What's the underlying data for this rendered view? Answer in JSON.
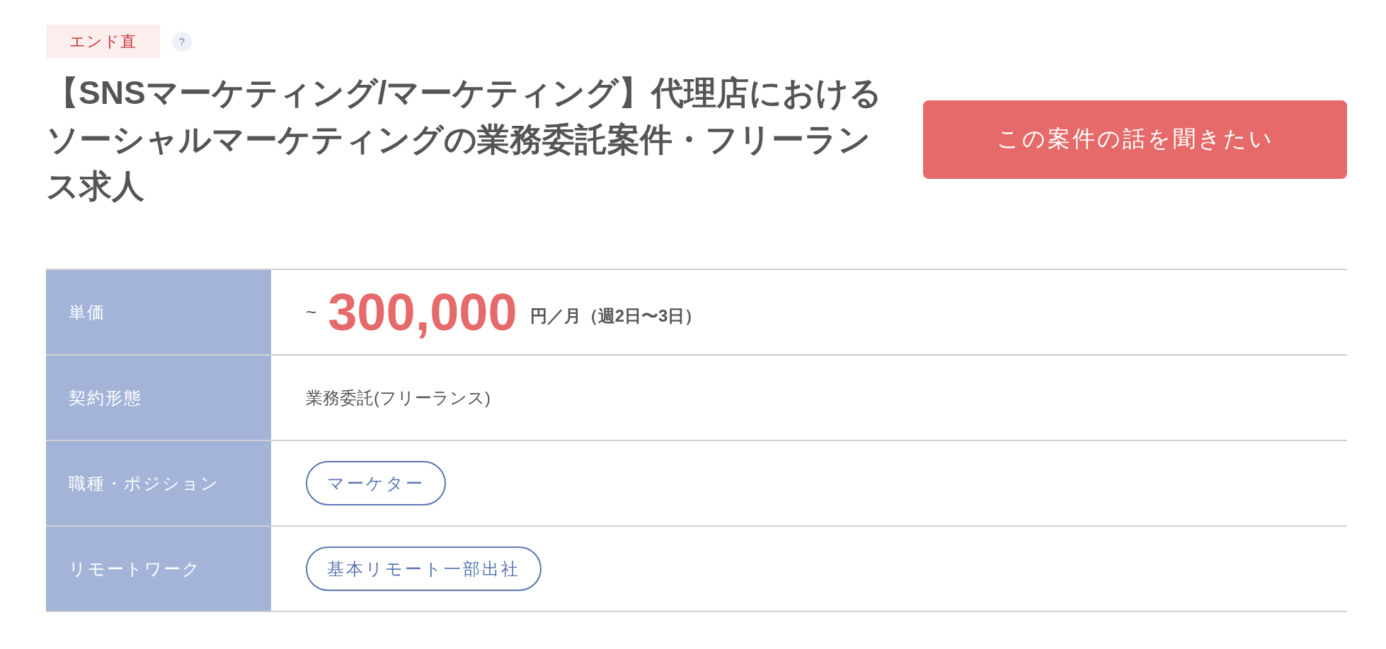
{
  "badge": "エンド直",
  "help_icon": "?",
  "title": "【SNSマーケティング/マーケティング】代理店におけるソーシャルマーケティングの業務委託案件・フリーランス求人",
  "cta_button": "この案件の話を聞きたい",
  "rows": [
    {
      "kind": "price",
      "label": "単価",
      "prefix": "~",
      "amount": "300,000",
      "suffix": "円／月（週2日〜3日）"
    },
    {
      "kind": "text",
      "label": "契約形態",
      "value": "業務委託(フリーランス)"
    },
    {
      "kind": "tags",
      "label": "職種・ポジション",
      "tags": [
        "マーケター"
      ]
    },
    {
      "kind": "tags",
      "label": "リモートワーク",
      "tags": [
        "基本リモート一部出社"
      ]
    }
  ]
}
